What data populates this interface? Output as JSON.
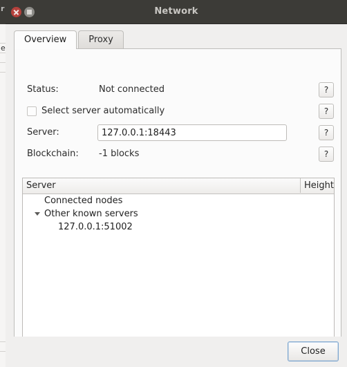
{
  "window": {
    "title": "Network",
    "controls": {
      "close": "close-button-icon",
      "maximize": "maximize-button-icon"
    }
  },
  "tabs": [
    {
      "label": "Overview",
      "active": true
    },
    {
      "label": "Proxy",
      "active": false
    }
  ],
  "overview": {
    "status": {
      "label": "Status:",
      "value": "Not connected",
      "help": "?"
    },
    "auto_select": {
      "label": "Select server automatically",
      "checked": false,
      "help": "?"
    },
    "server": {
      "label": "Server:",
      "value": "127.0.0.1:18443",
      "placeholder": "",
      "help": "?"
    },
    "blockchain": {
      "label": "Blockchain:",
      "value": "-1 blocks",
      "help": "?"
    },
    "tree": {
      "columns": [
        "Server",
        "Height"
      ],
      "rows": [
        {
          "name": "Connected nodes",
          "height": "",
          "level": 1,
          "twisty": false
        },
        {
          "name": "Other known servers",
          "height": "",
          "level": 1,
          "twisty": true
        },
        {
          "name": "127.0.0.1:51002",
          "height": "",
          "level": 2,
          "twisty": false
        }
      ]
    }
  },
  "footer": {
    "close_label": "Close"
  },
  "colors": {
    "titlebar": "#3c3b37",
    "titlebar_text": "#c9c7c3",
    "close_btn": "#b5413c",
    "maximize_btn": "#8d8c88",
    "dialog_bg": "#f0efee",
    "panel_bg": "#fbfbfb",
    "focus_border": "#7da7d0"
  }
}
